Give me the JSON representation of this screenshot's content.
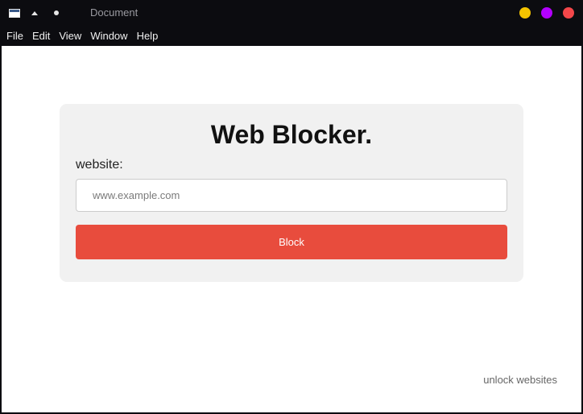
{
  "window": {
    "title": "Document",
    "icons": [
      "app-window-icon",
      "collapse-up-icon",
      "dot-icon"
    ],
    "controls": {
      "minimize_color": "#f5c400",
      "maximize_color": "#b300ff",
      "close_color": "#f4474a"
    }
  },
  "menubar": {
    "items": [
      "File",
      "Edit",
      "View",
      "Window",
      "Help"
    ]
  },
  "card": {
    "title": "Web Blocker.",
    "field_label": "website:",
    "input": {
      "value": "",
      "placeholder": "www.example.com"
    },
    "button_label": "Block",
    "button_color": "#e84c3d"
  },
  "footer": {
    "unlock_link": "unlock websites"
  }
}
